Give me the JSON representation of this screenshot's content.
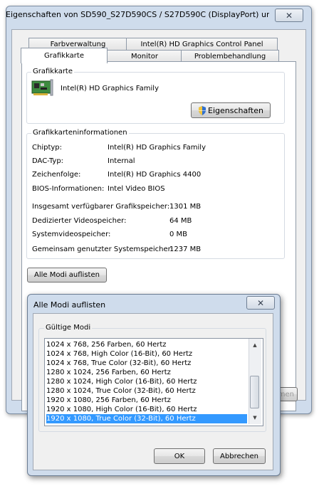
{
  "main_window": {
    "title": "Eigenschaften von SD590_S27D590CS / S27D590C (DisplayPort) un...",
    "close_glyph": "✕",
    "tabs_row1": [
      "Farbverwaltung",
      "Intel(R) HD Graphics Control Panel"
    ],
    "tabs_row2": [
      "Grafikkarte",
      "Monitor",
      "Problembehandlung"
    ],
    "active_tab": "Grafikkarte",
    "adapter_group": {
      "title": "Grafikkarte",
      "adapter_name": "Intel(R) HD Graphics Family",
      "properties_button": "Eigenschaften"
    },
    "info_group": {
      "title": "Grafikkarteninformationen",
      "rows": [
        {
          "label": "Chiptyp:",
          "value": "Intel(R) HD Graphics Family"
        },
        {
          "label": "DAC-Typ:",
          "value": "Internal"
        },
        {
          "label": "Zeichenfolge:",
          "value": "Intel(R) HD Graphics 4400"
        },
        {
          "label": "BIOS-Informationen:",
          "value": "Intel Video BIOS"
        }
      ],
      "memory_rows": [
        {
          "label": "Insgesamt verfügbarer Grafikspeicher:",
          "value": "1301 MB"
        },
        {
          "label": "Dedizierter Videospeicher:",
          "value": "64 MB"
        },
        {
          "label": "Systemvideospeicher:",
          "value": "0 MB"
        },
        {
          "label": "Gemeinsam genutzter Systemspeicher:",
          "value": "1237 MB"
        }
      ]
    },
    "list_all_modes_button": "Alle Modi auflisten",
    "hidden_button_fragment": "nmen"
  },
  "dialog": {
    "title": "Alle Modi auflisten",
    "close_glyph": "✕",
    "group_title": "Gültige Modi",
    "modes": [
      "1024 x 768, 256 Farben, 60 Hertz",
      "1024 x 768, High Color (16-Bit), 60 Hertz",
      "1024 x 768, True Color (32-Bit), 60 Hertz",
      "1280 x 1024, 256 Farben, 60 Hertz",
      "1280 x 1024, High Color (16-Bit), 60 Hertz",
      "1280 x 1024, True Color (32-Bit), 60 Hertz",
      "1920 x 1080, 256 Farben, 60 Hertz",
      "1920 x 1080, High Color (16-Bit), 60 Hertz",
      "1920 x 1080, True Color (32-Bit), 60 Hertz"
    ],
    "selected_index": 8,
    "scroll_up_glyph": "▲",
    "scroll_down_glyph": "▼",
    "ok_button": "OK",
    "cancel_button": "Abbrechen"
  },
  "colors": {
    "window_frame": "#cfdcec",
    "selection": "#3399ff",
    "uac_shield_blue": "#2f6fd0",
    "uac_shield_yellow": "#f2c53d"
  },
  "icons": [
    "graphics-card-icon",
    "uac-shield-icon",
    "close-icon",
    "scroll-up-arrow-icon",
    "scroll-down-arrow-icon"
  ]
}
